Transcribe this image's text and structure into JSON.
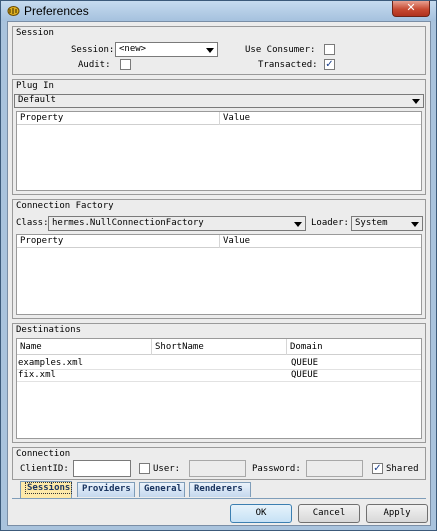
{
  "window": {
    "title": "Preferences",
    "close_label": "✕"
  },
  "session": {
    "title": "Session",
    "session_label": "Session:",
    "session_value": "<new>",
    "use_consumer_label": "Use Consumer:",
    "use_consumer_checked": false,
    "audit_label": "Audit:",
    "audit_checked": false,
    "transacted_label": "Transacted:",
    "transacted_checked": true
  },
  "plugin": {
    "title": "Plug In",
    "selected": "Default",
    "columns": [
      "Property",
      "Value"
    ]
  },
  "connection_factory": {
    "title": "Connection Factory",
    "class_label": "Class:",
    "class_value": "hermes.NullConnectionFactory",
    "loader_label": "Loader:",
    "loader_value": "System",
    "columns": [
      "Property",
      "Value"
    ]
  },
  "destinations": {
    "title": "Destinations",
    "columns": [
      "Name",
      "ShortName",
      "Domain"
    ],
    "rows": [
      {
        "name": "examples.xml",
        "short_name": "",
        "domain": "QUEUE"
      },
      {
        "name": "fix.xml",
        "short_name": "",
        "domain": "QUEUE"
      }
    ]
  },
  "connection": {
    "title": "Connection",
    "client_id_label": "ClientID:",
    "client_id_value": "",
    "user_label": "User:",
    "user_checked": false,
    "user_value": "",
    "password_label": "Password:",
    "password_value": "",
    "shared_label": "Shared",
    "shared_checked": true
  },
  "tabs": [
    "Sessions",
    "Providers",
    "General",
    "Renderers"
  ],
  "active_tab": "Sessions",
  "buttons": {
    "ok": "OK",
    "cancel": "Cancel",
    "apply": "Apply"
  }
}
